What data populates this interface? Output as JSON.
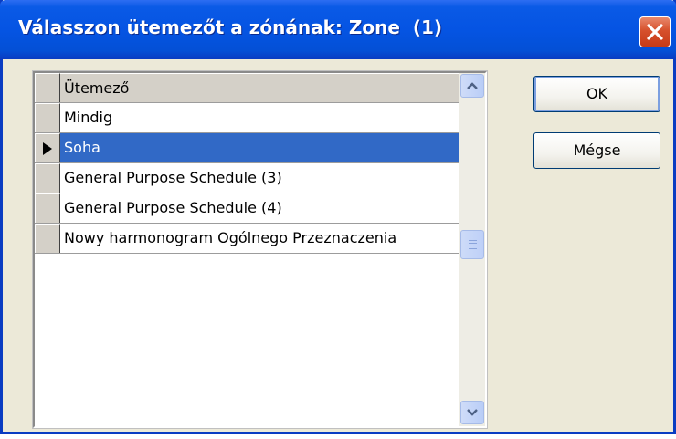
{
  "window": {
    "title": "Válasszon ütemezőt a zónának: Zone  (1)"
  },
  "grid": {
    "column_header": "Ütemező",
    "rows": [
      {
        "label": "Mindig",
        "selected": false
      },
      {
        "label": "Soha",
        "selected": true
      },
      {
        "label": "General Purpose Schedule (3)",
        "selected": false
      },
      {
        "label": "General Purpose Schedule (4)",
        "selected": false
      },
      {
        "label": "Nowy harmonogram Ogólnego Przeznaczenia",
        "selected": false
      }
    ],
    "current_row_icon": "current-row-arrow-icon"
  },
  "buttons": {
    "ok_label": "OK",
    "cancel_label": "Mégse"
  },
  "colors": {
    "title_bar": "#0554e3",
    "selection": "#3169c6",
    "close_button": "#d6502c",
    "dialog_bg": "#ece9d8"
  }
}
